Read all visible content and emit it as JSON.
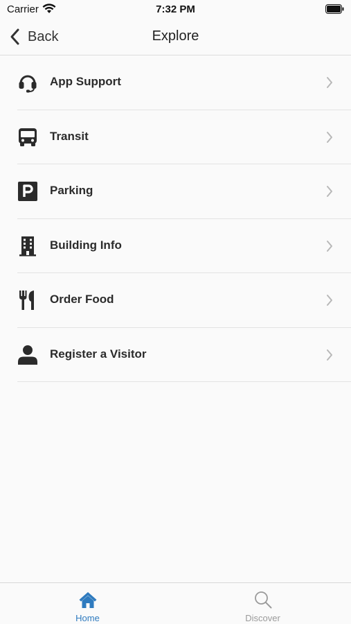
{
  "status_bar": {
    "carrier": "Carrier",
    "time": "7:32 PM"
  },
  "nav": {
    "back_label": "Back",
    "title": "Explore"
  },
  "menu": [
    {
      "label": "App Support",
      "icon": "headset-icon"
    },
    {
      "label": "Transit",
      "icon": "bus-icon"
    },
    {
      "label": "Parking",
      "icon": "parking-icon"
    },
    {
      "label": "Building Info",
      "icon": "building-icon"
    },
    {
      "label": "Order Food",
      "icon": "fork-knife-icon"
    },
    {
      "label": "Register a Visitor",
      "icon": "person-icon"
    }
  ],
  "tabs": [
    {
      "label": "Home",
      "icon": "home-icon",
      "active": true
    },
    {
      "label": "Discover",
      "icon": "search-icon",
      "active": false
    }
  ],
  "colors": {
    "accent": "#2f7bbf",
    "inactive": "#9a9a9a",
    "icon": "#2b2b2b",
    "background": "#fafafa"
  }
}
